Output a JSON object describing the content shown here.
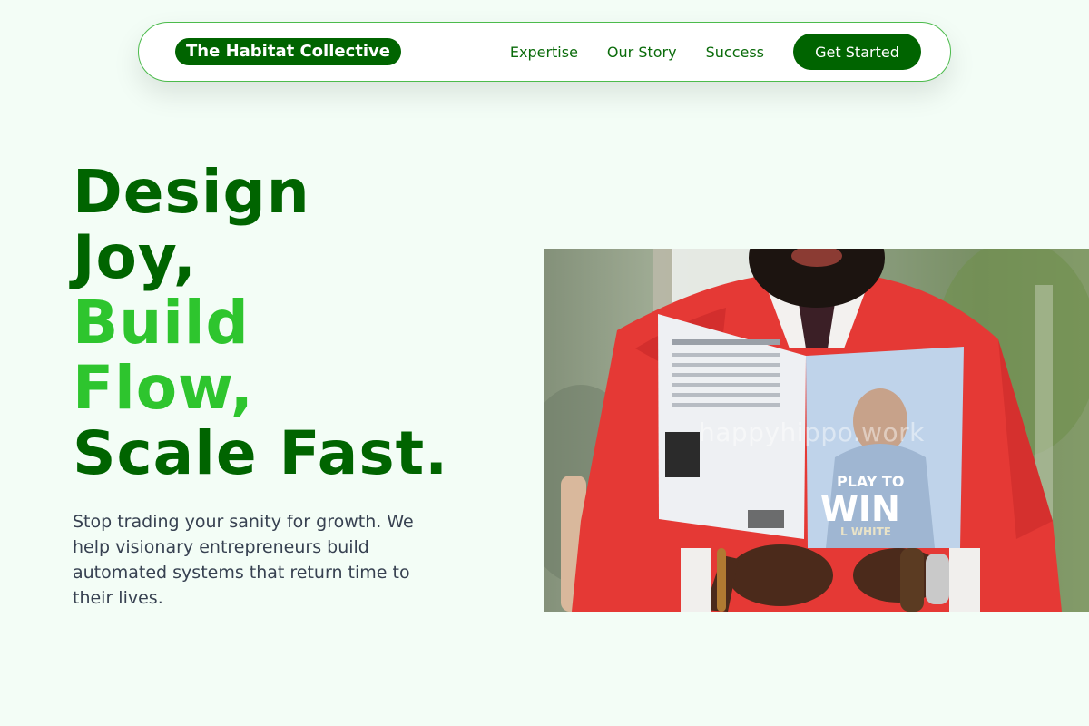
{
  "brand": {
    "name": "The Habitat Collective"
  },
  "nav": {
    "links": [
      "Expertise",
      "Our Story",
      "Success"
    ],
    "cta_label": "Get Started"
  },
  "hero": {
    "headline": {
      "line1": "Design",
      "line2": "Joy,",
      "line3": "Build",
      "line4": "Flow,",
      "line5": "Scale Fast."
    },
    "subtext": "Stop trading your sanity for growth. We help visionary entrepreneurs build automated systems that return time to their lives.",
    "image": {
      "watermark": "happyhippo.work",
      "book_title_top": "PLAY TO",
      "book_title_main": "WIN",
      "book_author": "L WHITE"
    }
  },
  "colors": {
    "brand_dark": "#006400",
    "brand_light": "#2ec52e",
    "background": "#f3fdf6",
    "jacket_red": "#e53935"
  }
}
